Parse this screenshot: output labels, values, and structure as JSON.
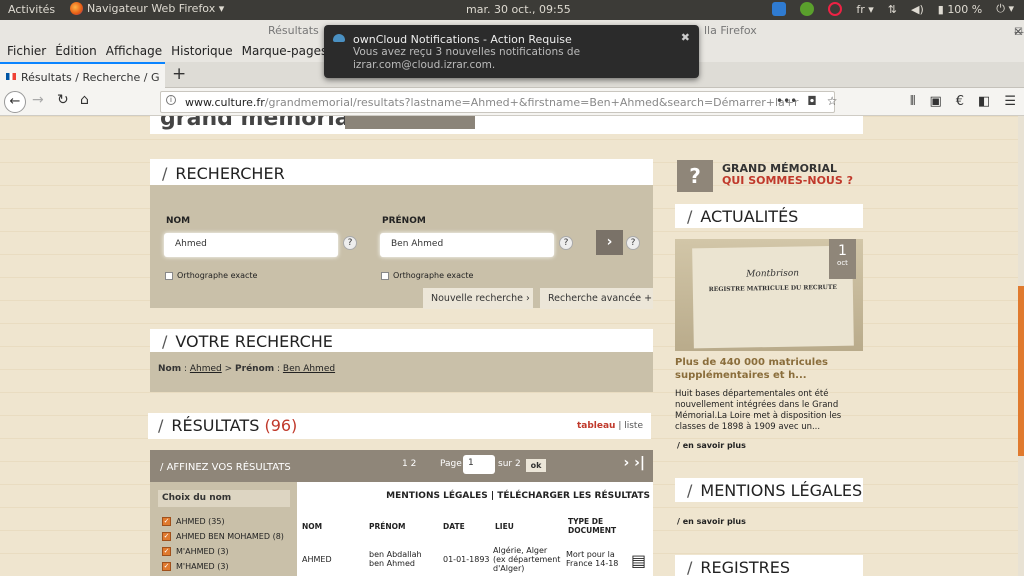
{
  "system": {
    "activities": "Activités",
    "app": "Navigateur Web Firefox ▾",
    "clock": "mar. 30 oct., 09:55",
    "lang": "fr ▾",
    "battery": "100 %"
  },
  "bg_window": {
    "left_title": "Résultats",
    "right_title": "lla Firefox"
  },
  "menu": [
    "Fichier",
    "Édition",
    "Affichage",
    "Historique",
    "Marque-pages"
  ],
  "tab": {
    "label": "Résultats / Recherche / G"
  },
  "url": {
    "domain": "www.culture.fr",
    "rest": "/grandmemorial/resultats?lastname=Ahmed+&firstname=Ben+Ahmed&search=Démarrer+la+r"
  },
  "notification": {
    "title": "ownCloud Notifications - Action Requise",
    "body": "Vous avez reçu 3 nouvelles notifications de izrar.com@cloud.izrar.com."
  },
  "search": {
    "heading": "RECHERCHER",
    "nom_label": "NOM",
    "nom_value": "Ahmed",
    "prenom_label": "PRÉNOM",
    "prenom_value": "Ben Ahmed",
    "exact": "Orthographe exacte",
    "new_search": "Nouvelle recherche",
    "adv_search": "Recherche avancée"
  },
  "votre": {
    "heading": "VOTRE RECHERCHE",
    "nom_key": "Nom",
    "nom_val": "Ahmed",
    "sep": ">",
    "prenom_key": "Prénom",
    "prenom_val": "Ben Ahmed"
  },
  "results": {
    "heading": "RÉSULTATS",
    "count": "(96)",
    "view_table": "tableau",
    "view_sep": "|",
    "view_list": "liste"
  },
  "filters": {
    "heading": "AFFINEZ VOS RÉSULTATS",
    "pages": "1  2",
    "page_label": "Page",
    "page_value": "1",
    "of": "sur 2",
    "ok": "ok",
    "choice_title": "Choix du nom",
    "items": [
      "AHMED (35)",
      "AHMED BEN MOHAMED (8)",
      "M'AHMED (3)",
      "M'HAMED (3)"
    ]
  },
  "table": {
    "links": "MENTIONS LÉGALES | TÉLÉCHARGER LES RÉSULTATS",
    "headers": [
      "NOM",
      "PRÉNOM",
      "DATE",
      "LIEU",
      "TYPE DE DOCUMENT"
    ],
    "row": [
      "AHMED",
      "ben Abdallah ben Ahmed",
      "01-01-1893",
      "Algérie, Alger (ex département d'Alger)",
      "Mort pour la France 14-18"
    ]
  },
  "sidebar": {
    "gm_title": "GRAND MÉMORIAL",
    "gm_sub": "QUI SOMMES-NOUS ?",
    "actualites": "ACTUALITÉS",
    "day": "1",
    "month": "oct",
    "news_title": "Plus de 440 000 matricules supplémentaires et h...",
    "news_text": "Huit bases départementales ont été nouvellement intégrées dans le Grand Mémorial.La Loire met à disposition les classes de 1898 à 1909 avec un...",
    "more": "/ en savoir plus",
    "mentions": "MENTIONS LÉGALES",
    "registres": "REGISTRES",
    "doc_text": "REGISTRE MATRICULE DU RECRUTE",
    "doc_place": "Montbrison"
  }
}
